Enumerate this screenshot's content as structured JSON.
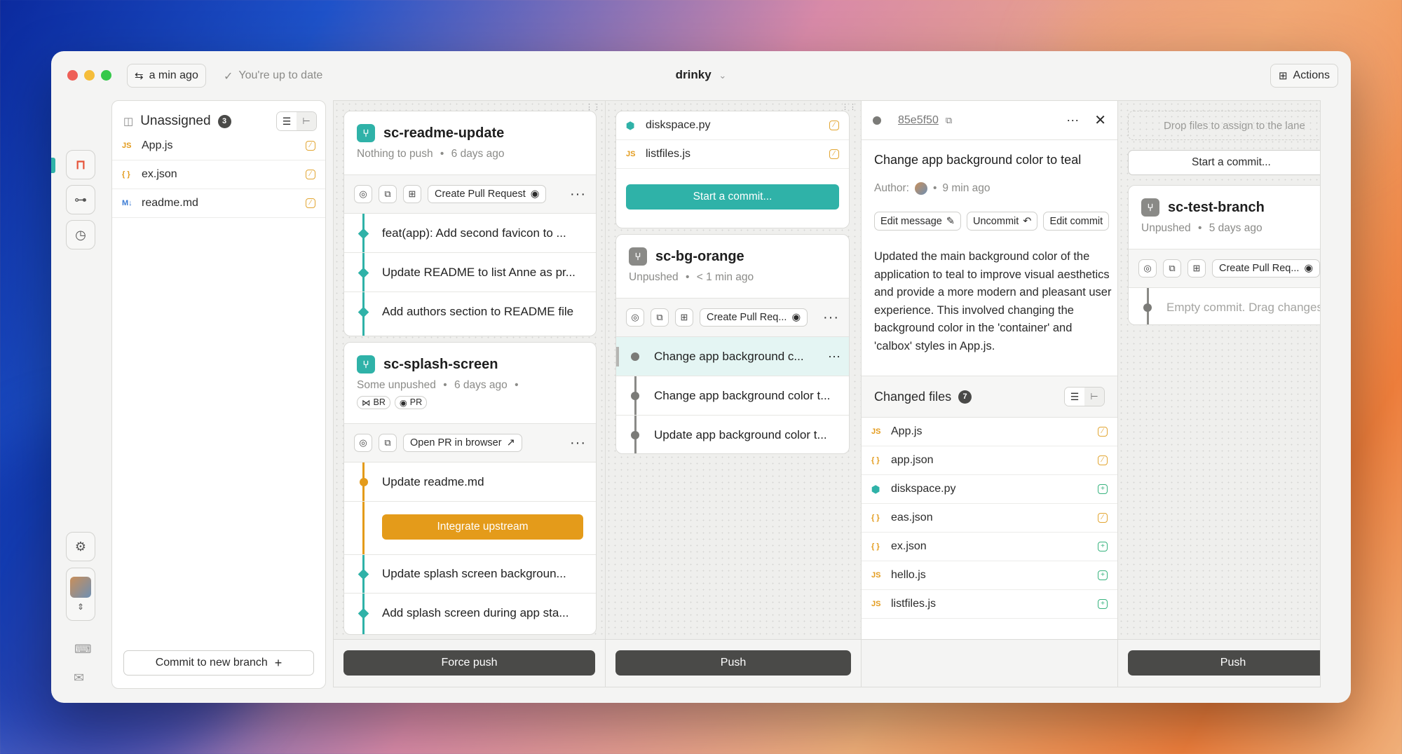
{
  "titlebar": {
    "sync_label": "a min ago",
    "status_label": "You're up to date",
    "project_name": "drinky",
    "actions_label": "Actions"
  },
  "unassigned": {
    "title": "Unassigned",
    "count": "3",
    "files": [
      {
        "type": "JS",
        "name": "App.js"
      },
      {
        "type": "{ }",
        "name": "ex.json"
      },
      {
        "type": "M↓",
        "name": "readme.md"
      }
    ],
    "commit_new_branch_label": "Commit to new branch"
  },
  "lane1": {
    "branch1": {
      "name": "sc-readme-update",
      "status": "Nothing to push",
      "time": "6 days ago",
      "pr_button": "Create Pull Request",
      "commits": [
        "feat(app): Add second favicon to ...",
        "Update README to list Anne as pr...",
        "Add authors section to README file"
      ]
    },
    "branch2": {
      "name": "sc-splash-screen",
      "status": "Some unpushed",
      "time": "6 days ago",
      "tag_br": "BR",
      "tag_pr": "PR",
      "pr_button": "Open PR in browser",
      "commits_top": "Update readme.md",
      "integrate_label": "Integrate upstream",
      "commits": [
        "Update splash screen backgroun...",
        "Add splash screen during app sta..."
      ]
    },
    "footer_button": "Force push"
  },
  "lane2": {
    "files": [
      {
        "type": "py",
        "name": "diskspace.py"
      },
      {
        "type": "JS",
        "name": "listfiles.js"
      }
    ],
    "start_commit_label": "Start a commit...",
    "branch": {
      "name": "sc-bg-orange",
      "status": "Unpushed",
      "time": "< 1 min ago",
      "pr_button": "Create Pull Req...",
      "commits": [
        "Change app background c...",
        "Change app background color t...",
        "Update app background color t..."
      ]
    },
    "footer_button": "Push"
  },
  "details": {
    "commit_hash": "85e5f50",
    "title": "Change app background color to teal",
    "author_label": "Author:",
    "time": "9 min ago",
    "edit_message": "Edit message",
    "uncommit": "Uncommit",
    "edit_commit": "Edit commit",
    "description": "Updated the main background color of the application to teal to improve visual aesthetics and provide a more modern and pleasant user experience. This involved changing the background color in the 'container' and 'calbox' styles in App.js.",
    "changed_files_title": "Changed files",
    "changed_count": "7",
    "files": [
      {
        "type": "JS",
        "name": "App.js",
        "status": "mod"
      },
      {
        "type": "{ }",
        "name": "app.json",
        "status": "mod"
      },
      {
        "type": "py",
        "name": "diskspace.py",
        "status": "add"
      },
      {
        "type": "{ }",
        "name": "eas.json",
        "status": "mod"
      },
      {
        "type": "{ }",
        "name": "ex.json",
        "status": "add"
      },
      {
        "type": "JS",
        "name": "hello.js",
        "status": "add"
      },
      {
        "type": "JS",
        "name": "listfiles.js",
        "status": "add"
      }
    ]
  },
  "lane3": {
    "drop_hint": "Drop files to assign to the lane",
    "start_commit_label": "Start a commit...",
    "branch": {
      "name": "sc-test-branch",
      "status": "Unpushed",
      "time": "5 days ago",
      "pr_button": "Create Pull Req...",
      "empty_commit": "Empty commit. Drag changes here"
    },
    "footer_button": "Push"
  },
  "colors": {
    "teal": "#2fb2a8",
    "orange_warn": "#e49b1a",
    "dark_button": "#4a4a48",
    "window_bg": "#f4f4f3"
  }
}
